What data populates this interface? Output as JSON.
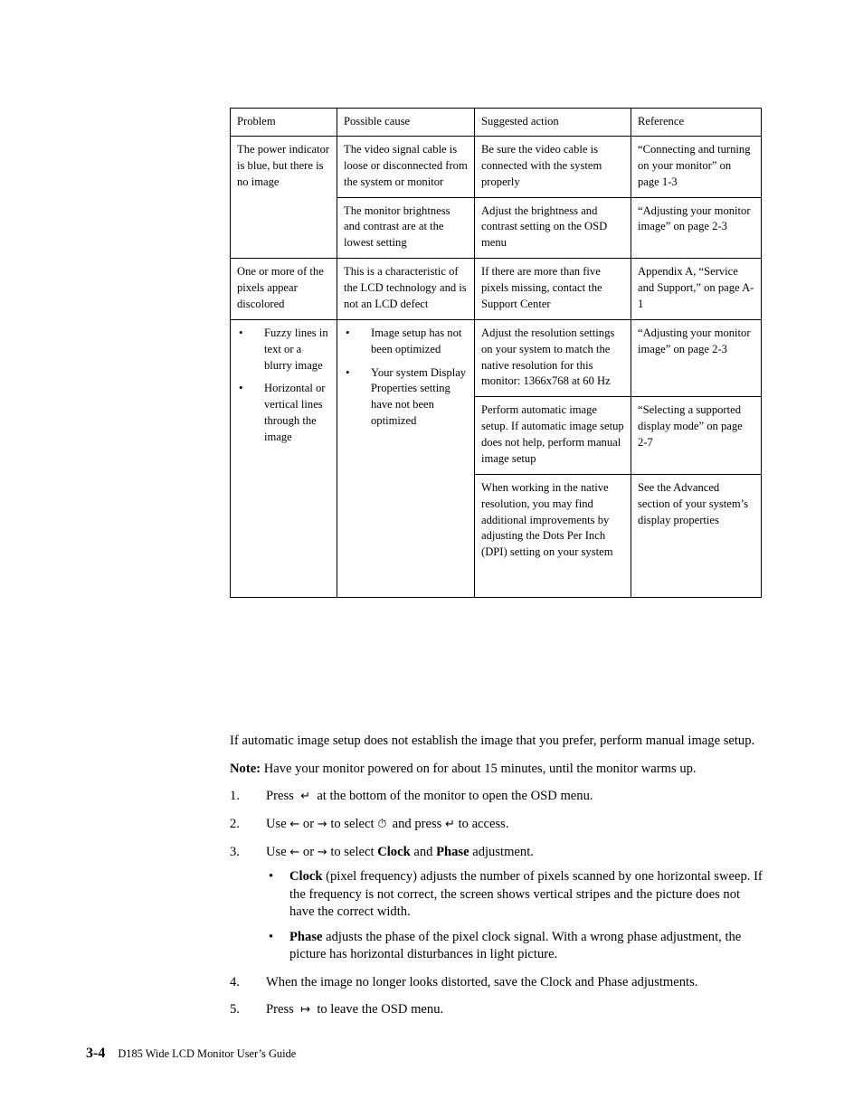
{
  "table": {
    "headers": [
      "Problem",
      "Possible cause",
      "Suggested action",
      "Reference"
    ],
    "rows": [
      {
        "problem": "The power indicator is blue, but there is no image",
        "cells": [
          {
            "cause": "The video signal cable is loose or disconnected from the system or monitor",
            "action": "Be sure the video cable is connected with the system properly",
            "reference": "“Connecting and turning on your monitor” on page 1-3"
          },
          {
            "cause": "The monitor brightness and contrast are at the lowest setting",
            "action": "Adjust the brightness and contrast setting on the OSD menu",
            "reference": "“Adjusting your monitor image” on page 2-3"
          }
        ]
      },
      {
        "problem": "One or more of the pixels appear discolored",
        "cells": [
          {
            "cause": "This is a characteristic of the LCD technology and is not an LCD defect",
            "action": "If there are more than five pixels missing, contact the Support Center",
            "reference": "Appendix A, “Service and Support,” on page A-1"
          }
        ]
      },
      {
        "problem_bullets": [
          "Fuzzy lines in text or a blurry image",
          "Horizontal or vertical lines through the image"
        ],
        "cause_bullets": [
          "Image setup has not been optimized",
          "Your system Display Properties setting have not been optimized"
        ],
        "cells": [
          {
            "action": "Adjust the resolution settings on your system to match the native resolution for this monitor: 1366x768 at 60 Hz",
            "reference": "“Adjusting your monitor image” on page 2-3"
          },
          {
            "action": "Perform automatic image setup.  If automatic image setup does not help, perform manual image setup",
            "reference": "“Selecting a supported display mode” on page 2-7"
          },
          {
            "action": "When working in the native resolution, you may find additional improvements by adjusting the Dots Per Inch (DPI) setting on your system",
            "reference": "See the Advanced section of your system’s display properties"
          }
        ]
      }
    ]
  },
  "body": {
    "intro": "If automatic image setup does not establish the image that you prefer, perform manual image setup.",
    "note_label": "Note:",
    "note_text": " Have your monitor powered on for about 15 minutes, until the monitor warms up.",
    "steps": [
      {
        "num": "1.",
        "parts": [
          "Press",
          "↵",
          "at the bottom of the monitor to open the OSD menu."
        ]
      },
      {
        "num": "2.",
        "parts": [
          "Use",
          "←",
          "or",
          "→",
          "to select",
          "⏱",
          "and press",
          "↵",
          "to access."
        ]
      },
      {
        "num": "3.",
        "parts": [
          "Use",
          "←",
          "or",
          "→",
          "to select",
          "Clock",
          "and",
          "Phase",
          "adjustment."
        ],
        "sub": [
          {
            "bold": "Clock",
            "text": " (pixel frequency) adjusts the number of pixels scanned by one horizontal sweep. If the frequency is not correct, the screen shows vertical stripes and the picture does not have the correct width."
          },
          {
            "bold": "Phase",
            "text": " adjusts the phase of the pixel clock signal. With a wrong phase adjustment, the picture has horizontal disturbances in light picture."
          }
        ]
      },
      {
        "num": "4.",
        "text": "When the image no longer looks distorted, save the Clock and Phase adjustments."
      },
      {
        "num": "5.",
        "parts": [
          "Press",
          "↦",
          "to leave the OSD menu."
        ]
      }
    ]
  },
  "footer": {
    "page_number": "3-4",
    "guide_title": "D185 Wide LCD Monitor User’s Guide"
  }
}
